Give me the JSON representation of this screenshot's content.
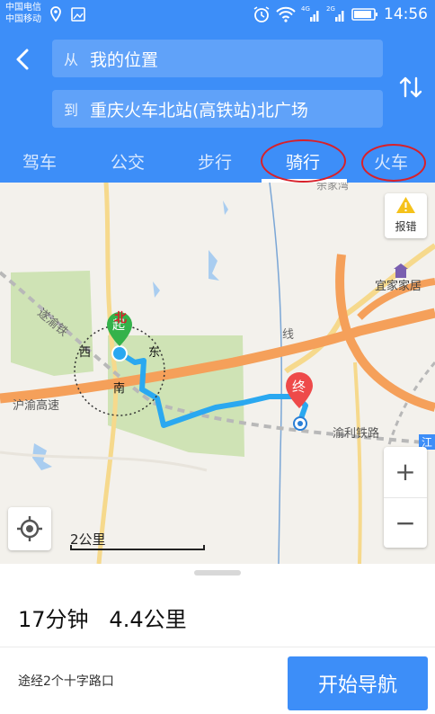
{
  "status_bar": {
    "carrier_1": "中国电信",
    "carrier_2": "中国移动",
    "net_1": "4G",
    "net_2": "2G",
    "time": "14:56"
  },
  "route": {
    "from_prefix": "从",
    "from_value": "我的位置",
    "to_prefix": "到",
    "to_value": "重庆火车北站(高铁站)北广场"
  },
  "tabs": [
    {
      "label": "驾车",
      "active": false
    },
    {
      "label": "公交",
      "active": false
    },
    {
      "label": "步行",
      "active": false
    },
    {
      "label": "骑行",
      "active": true
    },
    {
      "label": "火车",
      "active": false
    }
  ],
  "map": {
    "report_label": "报错",
    "zoom_in": "+",
    "zoom_out": "−",
    "scale_text": "2公里",
    "labels": {
      "yijiajiaju": "宜家家居",
      "huyu": "沪渝高速",
      "yuli": "渝利铁路",
      "suyu": "遂渝铁",
      "xian": "线",
      "top_partial": "余家湾",
      "right_partial": "江"
    },
    "compass": {
      "north": "北",
      "south": "南",
      "east": "东",
      "west": "西"
    },
    "start_marker": "起",
    "end_marker": "终"
  },
  "result": {
    "summary": "17分钟   4.4公里",
    "via": "途经2个十字路口",
    "nav_label": "开始导航"
  },
  "colors": {
    "primary": "#3d8ef8",
    "route": "#2aa8f0",
    "highway": "#f5a05a",
    "annotation": "#d8202a"
  }
}
